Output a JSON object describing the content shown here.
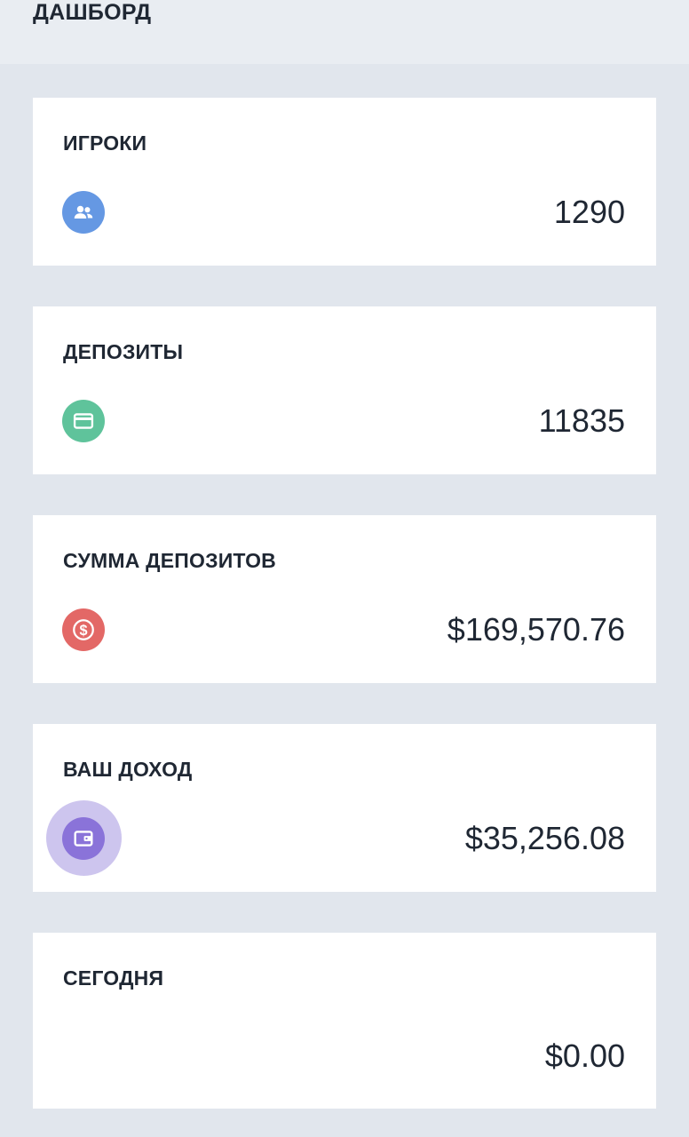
{
  "header": {
    "title": "ДАШБОРД"
  },
  "cards": [
    {
      "label": "ИГРОКИ",
      "value": "1290",
      "icon": "users-icon",
      "icon_color": "#6598e3"
    },
    {
      "label": "ДЕПОЗИТЫ",
      "value": "11835",
      "icon": "credit-card-icon",
      "icon_color": "#5fc39b"
    },
    {
      "label": "СУММА ДЕПОЗИТОВ",
      "value": "$169,570.76",
      "icon": "dollar-icon",
      "icon_color": "#e36866"
    },
    {
      "label": "ВАШ ДОХОД",
      "value": "$35,256.08",
      "icon": "wallet-icon",
      "icon_color": "#8a73d9"
    },
    {
      "label": "СЕГОДНЯ",
      "value": "$0.00"
    }
  ],
  "colors": {
    "background": "#e1e6ed",
    "header_background": "#e9edf2",
    "card_background": "#ffffff",
    "text": "#1f2733",
    "wallet_halo": "#cdc5ee"
  }
}
